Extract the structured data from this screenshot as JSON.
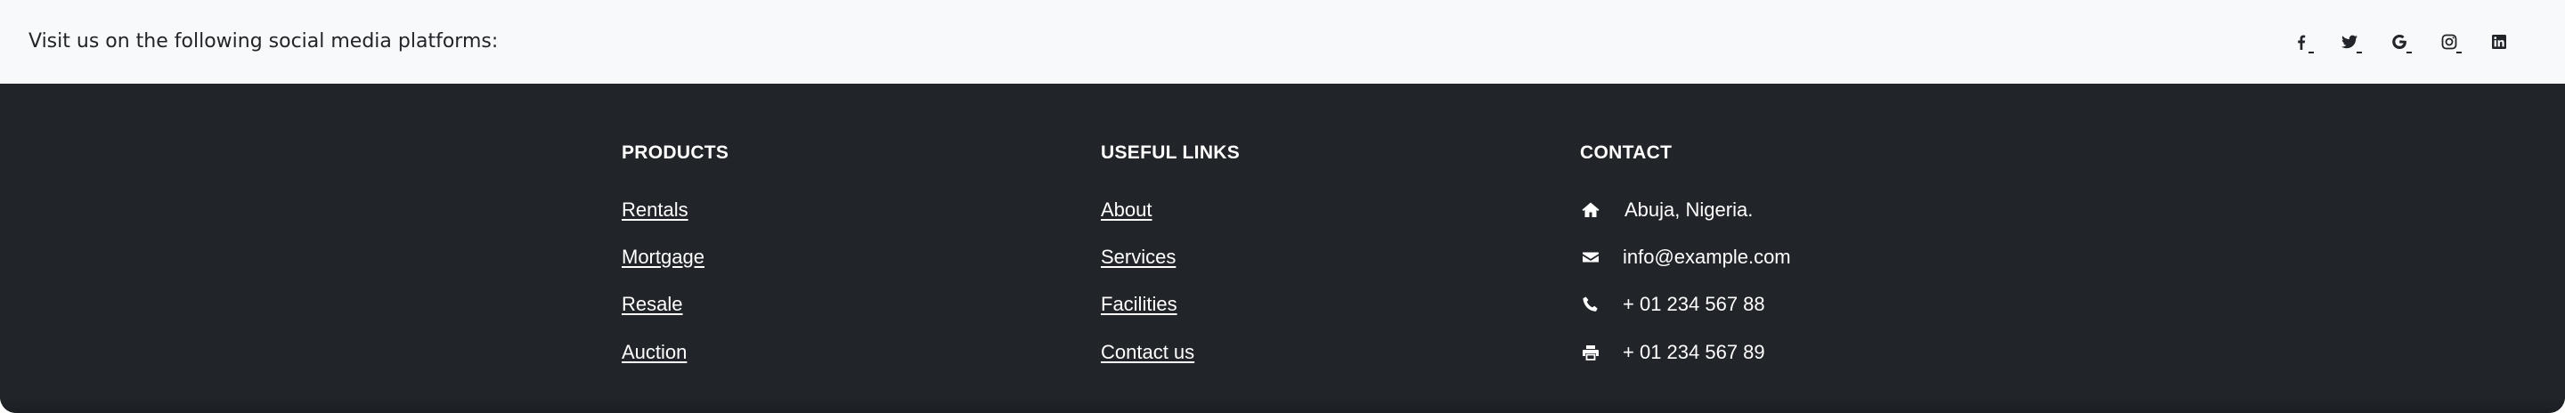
{
  "social_bar": {
    "text": "Visit us on the following social media platforms:",
    "icons": [
      {
        "name": "facebook-icon"
      },
      {
        "name": "twitter-icon"
      },
      {
        "name": "google-icon"
      },
      {
        "name": "instagram-icon"
      },
      {
        "name": "linkedin-icon"
      }
    ]
  },
  "footer": {
    "products": {
      "heading": "PRODUCTS",
      "links": [
        "Rentals",
        "Mortgage",
        "Resale",
        "Auction"
      ]
    },
    "useful_links": {
      "heading": "USEFUL LINKS",
      "links": [
        "About",
        "Services",
        "Facilities",
        "Contact us"
      ]
    },
    "contact": {
      "heading": "CONTACT",
      "address": "Abuja, Nigeria.",
      "email": "info@example.com",
      "phone": "+ 01 234 567 88",
      "fax": "+ 01 234 567 89",
      "icons": [
        "home-icon",
        "envelope-icon",
        "phone-icon",
        "print-icon"
      ]
    }
  },
  "colors": {
    "social_bar_bg": "#f8f9fa",
    "footer_bg": "#212529",
    "text_dark": "#212529",
    "text_light": "#ffffff"
  }
}
